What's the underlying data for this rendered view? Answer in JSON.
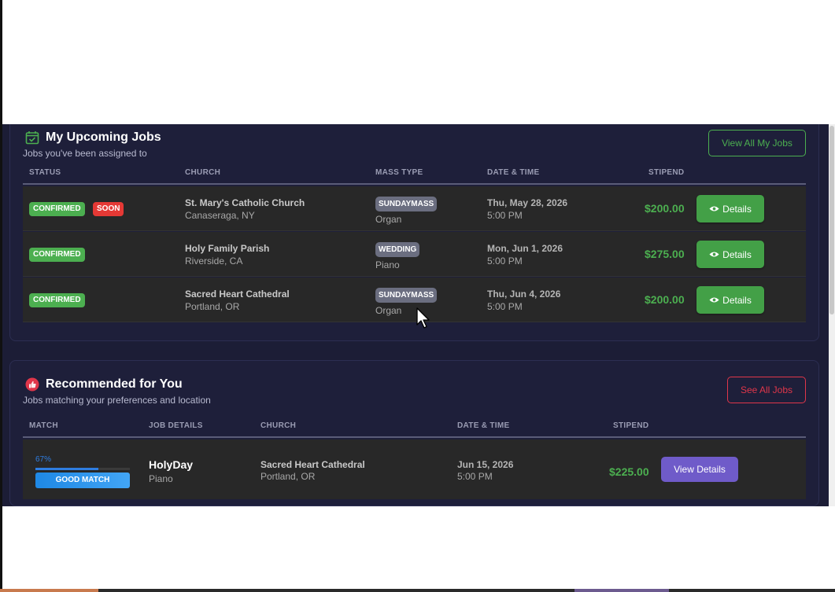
{
  "upcoming": {
    "title": "My Upcoming Jobs",
    "subtitle": "Jobs you've been assigned to",
    "view_all_label": "View All My Jobs",
    "columns": [
      "STATUS",
      "CHURCH",
      "MASS TYPE",
      "DATE & TIME",
      "STIPEND"
    ],
    "rows": [
      {
        "status": "CONFIRMED",
        "tag": "SOON",
        "church": "St. Mary's Catholic Church",
        "location": "Canaseraga, NY",
        "mass_type": "SUNDAYMASS",
        "instrument": "Organ",
        "date": "Thu, May 28, 2026",
        "time": "5:00 PM",
        "stipend": "$200.00",
        "action": "Details"
      },
      {
        "status": "CONFIRMED",
        "tag": "",
        "church": "Holy Family Parish",
        "location": "Riverside, CA",
        "mass_type": "WEDDING",
        "instrument": "Piano",
        "date": "Mon, Jun 1, 2026",
        "time": "5:00 PM",
        "stipend": "$275.00",
        "action": "Details"
      },
      {
        "status": "CONFIRMED",
        "tag": "",
        "church": "Sacred Heart Cathedral",
        "location": "Portland, OR",
        "mass_type": "SUNDAYMASS",
        "instrument": "Organ",
        "date": "Thu, Jun 4, 2026",
        "time": "5:00 PM",
        "stipend": "$200.00",
        "action": "Details"
      }
    ]
  },
  "recommended": {
    "title": "Recommended for You",
    "subtitle": "Jobs matching your preferences and location",
    "see_all_label": "See All Jobs",
    "columns": [
      "MATCH",
      "JOB DETAILS",
      "CHURCH",
      "DATE & TIME",
      "STIPEND"
    ],
    "rows": [
      {
        "match_pct": "67%",
        "match_fraction": 0.67,
        "match_label": "GOOD MATCH",
        "job_type": "HolyDay",
        "instrument": "Piano",
        "church": "Sacred Heart Cathedral",
        "location": "Portland, OR",
        "date": "Jun 15, 2026",
        "time": "5:00 PM",
        "stipend": "$225.00",
        "action": "View Details"
      }
    ]
  },
  "colors": {
    "accent_green": "#4caf50",
    "accent_red": "#e0364a",
    "accent_purple": "#6f5bc9",
    "match_blue": "#1e88e5",
    "card_bg": "#1e1f3a"
  },
  "icons": {
    "upcoming": "calendar-check-icon",
    "recommended": "thumbs-up-icon",
    "details": "eye-icon"
  }
}
